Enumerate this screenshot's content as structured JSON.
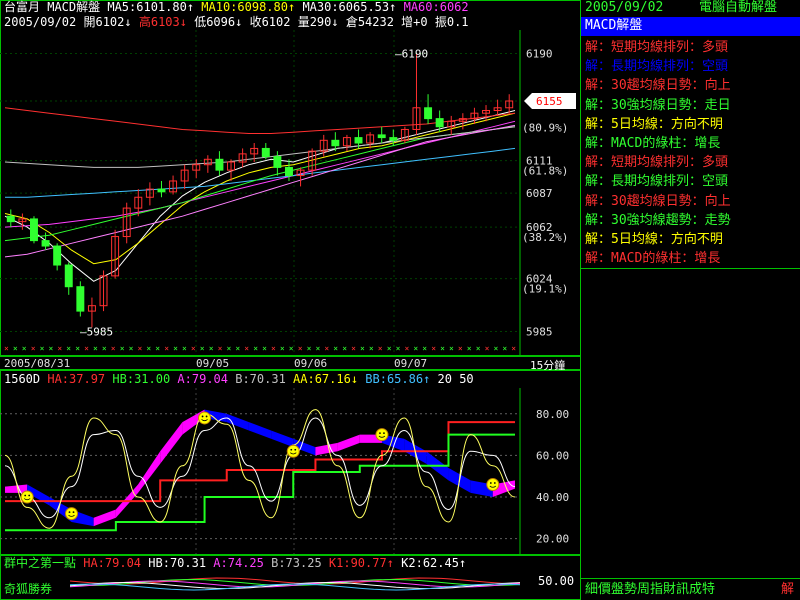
{
  "main_header": {
    "row1": [
      {
        "text": "台富月",
        "color": "#ffffff"
      },
      {
        "text": "MACD解盤",
        "color": "#ffffff"
      },
      {
        "text": "MA5:6101.80↑",
        "color": "#ffffff"
      },
      {
        "text": "MA10:6098.80↑",
        "color": "#ffff00"
      },
      {
        "text": "MA30:6065.53↑",
        "color": "#ffffff"
      },
      {
        "text": "MA60:6062",
        "color": "#ff40ff"
      }
    ],
    "row2": [
      {
        "text": "2005/09/02",
        "color": "#ffffff"
      },
      {
        "text": "開6102↓",
        "color": "#ffffff"
      },
      {
        "text": "高6103↓",
        "color": "#ff3030"
      },
      {
        "text": "低6096↓",
        "color": "#ffffff"
      },
      {
        "text": "收6102",
        "color": "#ffffff"
      },
      {
        "text": "量290↓",
        "color": "#ffffff"
      },
      {
        "text": "倉54232",
        "color": "#ffffff"
      },
      {
        "text": "增+0",
        "color": "#ffffff"
      },
      {
        "text": "振0.1",
        "color": "#ffffff"
      }
    ]
  },
  "price_axis": {
    "ticks": [
      "6190",
      "6155",
      "6111",
      "6087",
      "6062",
      "6024",
      "5985"
    ],
    "tick_values": [
      6190,
      6155,
      6111,
      6087,
      6062,
      6024,
      5985
    ],
    "fib": [
      "(80.9%)",
      "(61.8%)",
      "(38.2%)",
      "(19.1%)"
    ],
    "fib_values": [
      6143,
      6111,
      6062,
      6024
    ],
    "current": "6155",
    "high_label": "6190",
    "low_label": "5985"
  },
  "date_bar": {
    "start": "2005/08/31",
    "dates": [
      "09/05",
      "09/06",
      "09/07"
    ],
    "period": "15分鐘"
  },
  "indicator_header": [
    {
      "text": "1560D",
      "color": "#ffffff"
    },
    {
      "text": "HA:37.97",
      "color": "#ff3030"
    },
    {
      "text": "HB:31.00",
      "color": "#30ff30"
    },
    {
      "text": "A:79.04",
      "color": "#ff40ff"
    },
    {
      "text": "B:70.31",
      "color": "#c0c0c0"
    },
    {
      "text": "AA:67.16↓",
      "color": "#ffff00"
    },
    {
      "text": "BB:65.86↑",
      "color": "#40c0ff"
    },
    {
      "text": "20",
      "color": "#ffffff"
    },
    {
      "text": "50",
      "color": "#ffffff"
    }
  ],
  "indicator_axis": {
    "ticks": [
      "80.00",
      "60.00",
      "40.00",
      "20.00"
    ],
    "values": [
      80,
      60,
      40,
      20
    ]
  },
  "bottom_header": [
    {
      "text": "群中之第一點",
      "color": "#30ff30"
    },
    {
      "text": "HA:79.04",
      "color": "#ff3030"
    },
    {
      "text": "HB:70.31",
      "color": "#ffffff"
    },
    {
      "text": "A:74.25",
      "color": "#ff40ff"
    },
    {
      "text": "B:73.25",
      "color": "#c0c0c0"
    },
    {
      "text": "K1:90.77↑",
      "color": "#ff3030"
    },
    {
      "text": "K2:62.45↑",
      "color": "#ffffff"
    }
  ],
  "bottom_title": "奇狐勝券",
  "bottom_axis": "50.00",
  "right_panel": {
    "date": "2005/09/02",
    "title": "電腦自動解盤",
    "section": "MACD解盤",
    "items": [
      {
        "prefix": "解：",
        "text": "短期均線排列：多頭",
        "color": "#ff3030",
        "box": "#ff3030"
      },
      {
        "prefix": "解：",
        "text": "長期均線排列：空頭",
        "color": "#0000ff",
        "box": "#0000ff"
      },
      {
        "prefix": "解：",
        "text": "30趨均線日勢：向上",
        "color": "#ff3030",
        "box": "#ff3030"
      },
      {
        "prefix": "解：",
        "text": "30強均線日勢：走日",
        "color": "#30ff30",
        "box": "#30ff30"
      },
      {
        "prefix": "解：",
        "text": "5日均線：方向不明",
        "color": "#ffff00",
        "box": "#ffff00"
      },
      {
        "prefix": "解：",
        "text": "MACD的綠柱：增長",
        "color": "#30ff30",
        "box": "#30ff30"
      },
      {
        "prefix": "解：",
        "text": "短期均線排列：多頭",
        "color": "#ff3030",
        "box": "#ff3030"
      },
      {
        "prefix": "解：",
        "text": "長期均線排列：空頭",
        "color": "#30ff30",
        "box": "#30ff30"
      },
      {
        "prefix": "解：",
        "text": "30趨均線日勢：向上",
        "color": "#ff3030",
        "box": "#ff3030"
      },
      {
        "prefix": "解：",
        "text": "30強均線趨勢：走勢",
        "color": "#30ff30",
        "box": "#30ff30"
      },
      {
        "prefix": "解：",
        "text": "5日均線：方向不明",
        "color": "#ffff00",
        "box": "#ffff00"
      },
      {
        "prefix": "解：",
        "text": "MACD的綠柱：增長",
        "color": "#ff3030",
        "box": "#ff3030"
      }
    ],
    "footer": "細價盤勢周指財訊成特",
    "footer_accent": "解"
  },
  "chart_data": {
    "type": "line",
    "ylim": [
      5975,
      6200
    ],
    "candles": [
      [
        6070,
        6075,
        6062,
        6066
      ],
      [
        6066,
        6072,
        6060,
        6068
      ],
      [
        6068,
        6070,
        6050,
        6052
      ],
      [
        6052,
        6058,
        6045,
        6048
      ],
      [
        6048,
        6050,
        6030,
        6034
      ],
      [
        6034,
        6036,
        6012,
        6018
      ],
      [
        6018,
        6022,
        5996,
        6000
      ],
      [
        6000,
        6010,
        5988,
        6004
      ],
      [
        6004,
        6030,
        6000,
        6026
      ],
      [
        6026,
        6060,
        6024,
        6055
      ],
      [
        6055,
        6080,
        6050,
        6076
      ],
      [
        6076,
        6090,
        6070,
        6084
      ],
      [
        6084,
        6095,
        6078,
        6090
      ],
      [
        6090,
        6096,
        6084,
        6088
      ],
      [
        6088,
        6100,
        6086,
        6096
      ],
      [
        6096,
        6108,
        6090,
        6104
      ],
      [
        6104,
        6112,
        6098,
        6108
      ],
      [
        6108,
        6115,
        6102,
        6112
      ],
      [
        6112,
        6118,
        6100,
        6104
      ],
      [
        6104,
        6112,
        6096,
        6110
      ],
      [
        6110,
        6120,
        6106,
        6116
      ],
      [
        6116,
        6124,
        6110,
        6120
      ],
      [
        6120,
        6124,
        6112,
        6114
      ],
      [
        6114,
        6118,
        6100,
        6106
      ],
      [
        6106,
        6112,
        6096,
        6100
      ],
      [
        6100,
        6106,
        6092,
        6104
      ],
      [
        6104,
        6120,
        6100,
        6118
      ],
      [
        6118,
        6130,
        6114,
        6126
      ],
      [
        6126,
        6132,
        6118,
        6122
      ],
      [
        6122,
        6130,
        6118,
        6128
      ],
      [
        6128,
        6134,
        6120,
        6124
      ],
      [
        6124,
        6132,
        6120,
        6130
      ],
      [
        6130,
        6136,
        6124,
        6128
      ],
      [
        6128,
        6134,
        6122,
        6126
      ],
      [
        6126,
        6136,
        6124,
        6134
      ],
      [
        6134,
        6190,
        6130,
        6150
      ],
      [
        6150,
        6160,
        6138,
        6142
      ],
      [
        6142,
        6148,
        6132,
        6136
      ],
      [
        6136,
        6144,
        6130,
        6140
      ],
      [
        6140,
        6146,
        6134,
        6142
      ],
      [
        6142,
        6150,
        6138,
        6146
      ],
      [
        6146,
        6152,
        6140,
        6148
      ],
      [
        6148,
        6156,
        6144,
        6150
      ],
      [
        6150,
        6160,
        6146,
        6155
      ]
    ],
    "ma_lines": [
      {
        "color": "#ffffff",
        "values": [
          6070,
          6062,
          6050,
          6035,
          6022,
          6030,
          6050,
          6070,
          6085,
          6095,
          6102,
          6108,
          6112,
          6110,
          6115,
          6120,
          6122,
          6124,
          6128,
          6132,
          6136,
          6140,
          6144,
          6148
        ]
      },
      {
        "color": "#ffff00",
        "values": [
          6072,
          6068,
          6058,
          6045,
          6035,
          6038,
          6050,
          6064,
          6078,
          6088,
          6096,
          6102,
          6106,
          6108,
          6112,
          6116,
          6120,
          6122,
          6126,
          6130,
          6134,
          6138,
          6142,
          6146
        ]
      },
      {
        "color": "#ff3030",
        "values": [
          6150,
          6148,
          6146,
          6144,
          6142,
          6140,
          6138,
          6136,
          6134,
          6133,
          6132,
          6131,
          6131,
          6132,
          6133,
          6134,
          6135,
          6136,
          6137,
          6138,
          6140,
          6142,
          6144,
          6146
        ]
      },
      {
        "color": "#ff40ff",
        "values": [
          6062,
          6063,
          6064,
          6066,
          6068,
          6070,
          6073,
          6076,
          6080,
          6084,
          6088,
          6092,
          6096,
          6100,
          6104,
          6108,
          6112,
          6116,
          6120,
          6124,
          6128,
          6132,
          6136,
          6140
        ]
      },
      {
        "color": "#40c0ff",
        "values": [
          6084,
          6084,
          6085,
          6086,
          6087,
          6088,
          6089,
          6090,
          6091,
          6092,
          6094,
          6096,
          6098,
          6100,
          6102,
          6104,
          6106,
          6108,
          6110,
          6112,
          6114,
          6116,
          6118,
          6120
        ]
      },
      {
        "color": "#30ff30",
        "values": [
          6052,
          6054,
          6056,
          6060,
          6064,
          6068,
          6072,
          6076,
          6080,
          6085,
          6090,
          6095,
          6100,
          6104,
          6108,
          6112,
          6116,
          6120,
          6124,
          6128,
          6130,
          6132,
          6134,
          6136
        ]
      },
      {
        "color": "#c0c0c0",
        "values": [
          6110,
          6109,
          6108,
          6107,
          6106,
          6106,
          6106,
          6107,
          6108,
          6109,
          6110,
          6112,
          6114,
          6116,
          6118,
          6120,
          6122,
          6124,
          6126,
          6128,
          6130,
          6132,
          6134,
          6136
        ]
      },
      {
        "color": "#ff80ff",
        "values": [
          6040,
          6042,
          6046,
          6050,
          6054,
          6058,
          6062,
          6066,
          6070,
          6075,
          6080,
          6085,
          6090,
          6095,
          6100,
          6105,
          6110,
          6115,
          6120,
          6125,
          6128,
          6131,
          6134,
          6137
        ]
      }
    ],
    "indicator": {
      "ylim": [
        15,
        90
      ],
      "red_step": [
        38,
        38,
        38,
        38,
        38,
        38,
        38,
        48,
        48,
        48,
        53,
        53,
        53,
        53,
        58,
        58,
        58,
        62,
        62,
        62,
        76,
        76,
        76,
        76
      ],
      "green_step": [
        24,
        24,
        24,
        24,
        24,
        28,
        28,
        28,
        28,
        40,
        40,
        40,
        40,
        52,
        52,
        52,
        55,
        55,
        55,
        55,
        70,
        70,
        70,
        70
      ],
      "band_a": [
        45,
        46,
        40,
        34,
        30,
        34,
        46,
        62,
        76,
        82,
        80,
        76,
        72,
        68,
        64,
        66,
        70,
        70,
        68,
        62,
        54,
        48,
        46,
        48
      ],
      "band_b": [
        42,
        42,
        36,
        28,
        26,
        30,
        42,
        56,
        70,
        78,
        76,
        72,
        68,
        64,
        60,
        62,
        66,
        66,
        62,
        56,
        48,
        42,
        40,
        44
      ],
      "yellow_osc": [
        60,
        35,
        25,
        50,
        78,
        70,
        40,
        28,
        55,
        80,
        75,
        48,
        30,
        65,
        82,
        55,
        30,
        60,
        78,
        45,
        28,
        70,
        55,
        40
      ],
      "white_osc": [
        55,
        40,
        30,
        45,
        70,
        72,
        50,
        35,
        50,
        72,
        78,
        55,
        38,
        60,
        78,
        60,
        36,
        55,
        72,
        52,
        34,
        62,
        60,
        45
      ],
      "smileys": [
        [
          1,
          40
        ],
        [
          3,
          32
        ],
        [
          9,
          78
        ],
        [
          13,
          62
        ],
        [
          17,
          70
        ],
        [
          22,
          46
        ]
      ]
    }
  }
}
